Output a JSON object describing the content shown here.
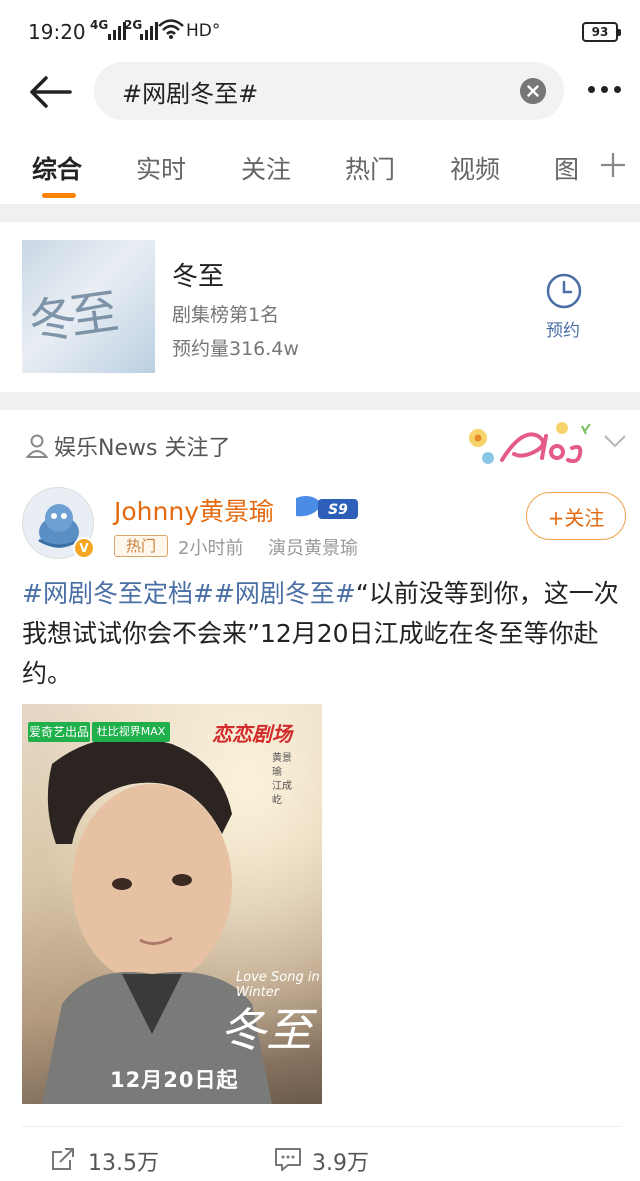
{
  "status_bar": {
    "time": "19:20",
    "net1": "4G",
    "net2": "2G",
    "hd": "HD°",
    "battery": "93"
  },
  "search": {
    "query": "#网剧冬至#"
  },
  "tabs": [
    "综合",
    "实时",
    "关注",
    "热门",
    "视频",
    "图"
  ],
  "drama_card": {
    "title": "冬至",
    "rank": "剧集榜第1名",
    "bookings": "预约量316.4w",
    "reserve_label": "预约",
    "cover_text": "冬至"
  },
  "followed_note": "娱乐News 关注了",
  "post": {
    "author": "Johnny黄景瑜",
    "vip_label": "S9",
    "hot_tag": "热门",
    "time": "2小时前",
    "source": "演员黄景瑜",
    "follow_label": "+关注",
    "tag1": "#网剧冬至定档#",
    "tag2": "#网剧冬至#",
    "text": "“以前没等到你，这一次我想试试你会不会来”12月20日江成屹在冬至等你赴约。"
  },
  "poster": {
    "brand1": "爱奇艺出品",
    "brand2": "杜比视界MAX",
    "theater": "恋恋剧场",
    "cast": "黄景瑜 江成屹",
    "title_en": "Love Song in Winter",
    "title_cn": "冬至",
    "date": "12月20日起"
  },
  "footer": {
    "reposts": "13.5万",
    "comments": "3.9万"
  },
  "colors": {
    "accent": "#ff8200",
    "author": "#e46a0f",
    "link": "#4a6fa5"
  }
}
